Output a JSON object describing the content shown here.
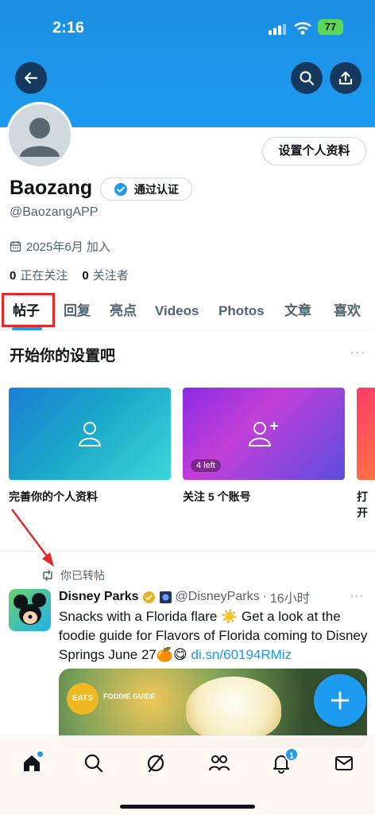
{
  "status_bar": {
    "time": "2:16",
    "battery": "77"
  },
  "header": {
    "back": "back-arrow-icon",
    "search": "search-icon",
    "share": "share-icon"
  },
  "profile": {
    "edit_label": "设置个人资料",
    "name": "Baozang",
    "verify_label": "通过认证",
    "handle": "@BaozangAPP",
    "joined": "2025年6月 加入",
    "following_count": "0",
    "following_label": "正在关注",
    "followers_count": "0",
    "followers_label": "关注者"
  },
  "tabs": [
    {
      "label": "帖子",
      "active": true
    },
    {
      "label": "回复"
    },
    {
      "label": "亮点"
    },
    {
      "label": "Videos"
    },
    {
      "label": "Photos"
    },
    {
      "label": "文章"
    },
    {
      "label": "喜欢"
    }
  ],
  "setup": {
    "title": "开始你的设置吧",
    "more": "···",
    "cards": [
      {
        "label": "完善你的个人资料"
      },
      {
        "label": "关注 5 个账号",
        "pill": "4 left"
      },
      {
        "label": "打开"
      }
    ]
  },
  "post": {
    "retweet_label": "你已转帖",
    "author": "Disney Parks",
    "handle": "@DisneyParks",
    "sep": "·",
    "time": "16小时",
    "more": "···",
    "text_1": "Snacks with a Florida flare ☀️ Get a look at the foodie guide for Flavors of Florida coming to Disney Springs June 27🍊😋 ",
    "link": "di.sn/60194RMiz",
    "image_tag": "EATS",
    "image_tag2": "FOODIE GUIDE"
  },
  "nav": {
    "notifications_badge": "1"
  },
  "colors": {
    "accent": "#1d9bf0",
    "highlight": "#e5282a"
  }
}
